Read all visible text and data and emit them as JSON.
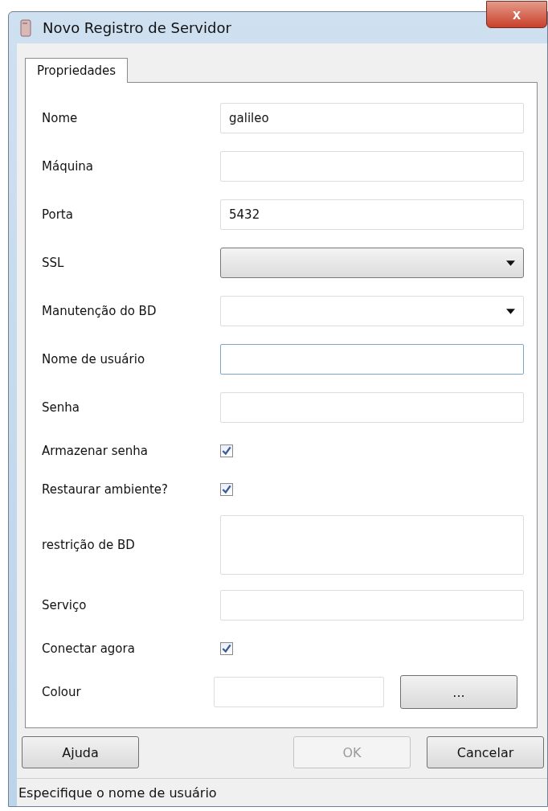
{
  "window": {
    "title": "Novo Registro de Servidor",
    "close": "x"
  },
  "tabs": [
    {
      "label": "Propriedades",
      "selected": true
    }
  ],
  "rows": [
    {
      "kind": "text",
      "label": "Nome",
      "value": "galileo",
      "focused": false
    },
    {
      "kind": "text",
      "label": "Máquina",
      "focused": false
    },
    {
      "kind": "text",
      "label": "Porta",
      "value": "5432",
      "focused": false
    },
    {
      "kind": "combo",
      "label": "SSL"
    },
    {
      "kind": "editable-combo",
      "label": "Manutenção do BD"
    },
    {
      "kind": "text",
      "label": "Nome de usuário",
      "focused": true
    },
    {
      "kind": "text",
      "label": "Senha",
      "focused": false
    },
    {
      "kind": "checkbox",
      "label": "Armazenar senha",
      "checked": true
    },
    {
      "kind": "checkbox",
      "label": "Restaurar ambiente?",
      "checked": true
    },
    {
      "kind": "textarea",
      "label": "restrição de BD"
    },
    {
      "kind": "text",
      "label": "Serviço",
      "focused": false
    },
    {
      "kind": "checkbox",
      "label": "Conectar agora",
      "checked": true
    },
    {
      "kind": "colour",
      "label": "Colour",
      "button": "..."
    }
  ],
  "buttons": [
    {
      "label": "Ajuda",
      "disabled": false
    },
    {
      "label": "OK",
      "disabled": true
    },
    {
      "label": "Cancelar",
      "disabled": false
    }
  ],
  "status_bar": "Especifique o nome de usuário"
}
